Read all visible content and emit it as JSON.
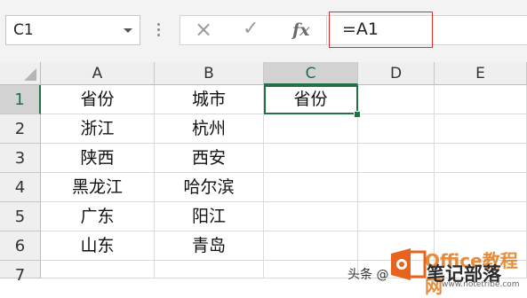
{
  "formula_bar": {
    "name_box": "C1",
    "cancel_icon": "×",
    "enter_icon": "✓",
    "fx_label": "fx",
    "formula": "=A1"
  },
  "columns": [
    "A",
    "B",
    "C",
    "D",
    "E"
  ],
  "selected_column": "C",
  "rows": [
    {
      "num": "1",
      "a": "省份",
      "b": "城市",
      "c": "省份"
    },
    {
      "num": "2",
      "a": "浙江",
      "b": "杭州",
      "c": ""
    },
    {
      "num": "3",
      "a": "陕西",
      "b": "西安",
      "c": ""
    },
    {
      "num": "4",
      "a": "黑龙江",
      "b": "哈尔滨",
      "c": ""
    },
    {
      "num": "5",
      "a": "广东",
      "b": "阳江",
      "c": ""
    },
    {
      "num": "6",
      "a": "山东",
      "b": "青岛",
      "c": ""
    },
    {
      "num": "7",
      "a": "",
      "b": "",
      "c": ""
    }
  ],
  "watermark": {
    "prefix": "头条 @",
    "brand": "Office教程网",
    "name": "笔记部落",
    "url": "www.notetribe.com"
  },
  "colors": {
    "accent": "#217346",
    "highlight_border": "#e22b2b",
    "header_bg": "#efefef"
  }
}
